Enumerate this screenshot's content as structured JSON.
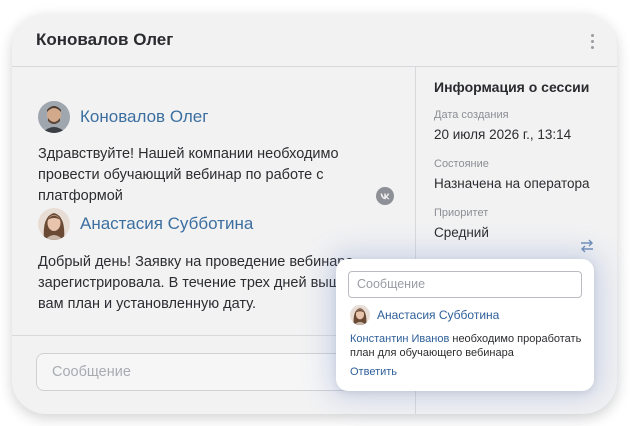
{
  "header": {
    "title": "Коновалов Олег"
  },
  "chat": {
    "messages": [
      {
        "author": "Коновалов Олег",
        "text": "Здравствуйте! Нашей компании необходимо провести обучающий вебинар по работе с платформой"
      },
      {
        "author": "Анастасия Субботина",
        "text": "Добрый день! Заявку на проведение вебинара зарегистрировала. В течение трех дней вышлю вам план и установленную дату."
      }
    ],
    "composer_placeholder": "Сообщение"
  },
  "session": {
    "title": "Информация о сессии",
    "created_label": "Дата создания",
    "created_value": "20 июля 2026 г., 13:14",
    "state_label": "Состояние",
    "state_value": "Назначена на оператора",
    "priority_label": "Приоритет",
    "priority_value": "Средний"
  },
  "popup": {
    "input_placeholder": "Сообщение",
    "author": "Анастасия Субботина",
    "mention": "Константин Иванов",
    "text": " необходимо проработать план для обучающего вебинара",
    "reply_label": "Ответить"
  },
  "colors": {
    "accent": "#3c6fa0",
    "link": "#2d5e99"
  },
  "icons": {
    "menu": "kebab-menu-icon",
    "channel": "vk-icon",
    "priority": "swap-arrows-icon"
  }
}
